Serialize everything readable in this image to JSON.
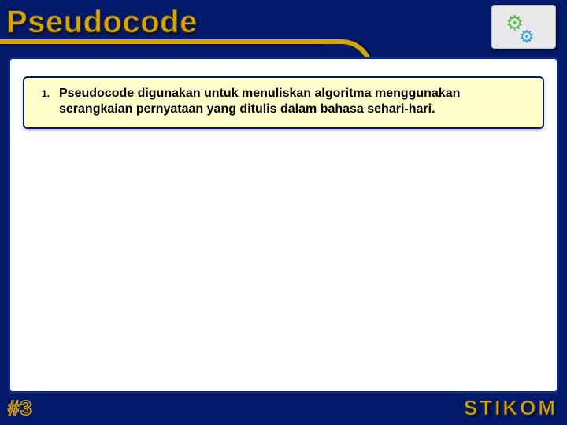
{
  "title": "Pseudocode",
  "logo": {
    "name": "gears-logo"
  },
  "note": {
    "number": "1.",
    "text": "Pseudocode digunakan untuk menuliskan algoritma menggunakan serangkaian pernyataan yang ditulis dalam bahasa sehari-hari."
  },
  "footer": {
    "page": "#3",
    "brand": "STIKOM"
  }
}
